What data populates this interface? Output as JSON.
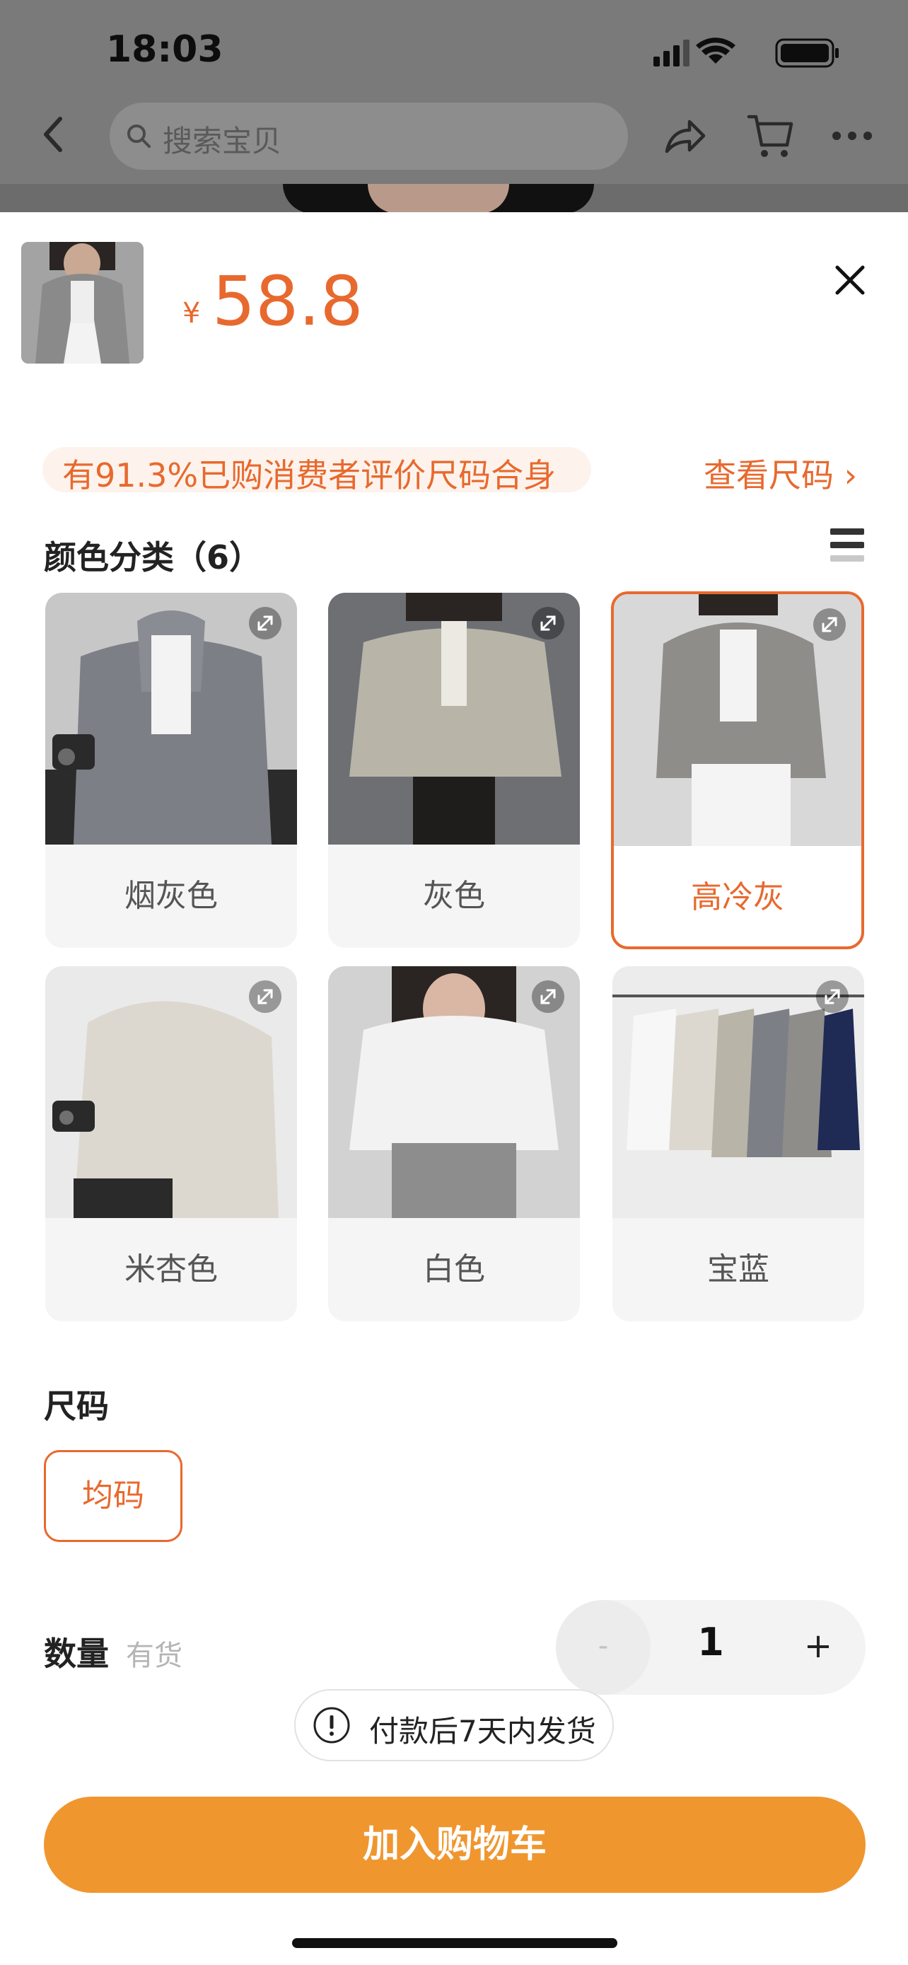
{
  "status_bar": {
    "time": "18:03"
  },
  "nav": {
    "search_placeholder": "搜索宝贝",
    "back_icon": "chevron-left-icon",
    "share_icon": "share-icon",
    "cart_icon": "cart-icon",
    "more_icon": "more-icon"
  },
  "product": {
    "currency": "¥",
    "price": "58.8"
  },
  "fit_notice": {
    "text": "有91.3%已购消费者评价尺码合身",
    "link": "查看尺码 ›"
  },
  "color_section": {
    "title": "颜色分类（6）",
    "options": [
      {
        "label": "烟灰色",
        "selected": false,
        "shade": "#7d7f86"
      },
      {
        "label": "灰色",
        "selected": false,
        "shade": "#b8b4a8"
      },
      {
        "label": "高冷灰",
        "selected": true,
        "shade": "#8e8d8a"
      },
      {
        "label": "米杏色",
        "selected": false,
        "shade": "#ddd8cf"
      },
      {
        "label": "白色",
        "selected": false,
        "shade": "#f2f2f2"
      },
      {
        "label": "宝蓝",
        "selected": false,
        "shade": "#1f2a55"
      }
    ]
  },
  "size_section": {
    "title": "尺码",
    "options": [
      "均码"
    ],
    "selected": "均码"
  },
  "quantity": {
    "label": "数量",
    "stock": "有货",
    "value": "1",
    "minus": "-",
    "plus": "+"
  },
  "shipping_notice": "付款后7天内发货",
  "cta": {
    "add_to_cart": "加入购物车"
  },
  "colors": {
    "accent": "#e8692e",
    "cta": "#f0962f"
  }
}
